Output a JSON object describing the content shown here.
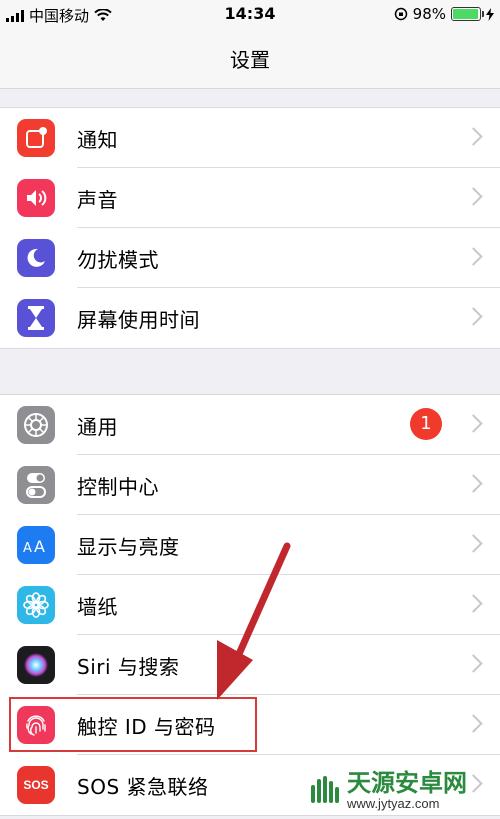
{
  "status_bar": {
    "carrier": "中国移动",
    "time": "14:34",
    "battery_percent": "98%",
    "battery_level": 0.98
  },
  "nav": {
    "title": "设置"
  },
  "group1": [
    {
      "label": "通知",
      "icon": "notifications-icon",
      "color": "#f23c30"
    },
    {
      "label": "声音",
      "icon": "sound-icon",
      "color": "#f2375a"
    },
    {
      "label": "勿扰模式",
      "icon": "moon-icon",
      "color": "#5a52d6"
    },
    {
      "label": "屏幕使用时间",
      "icon": "hourglass-icon",
      "color": "#5a52d6"
    }
  ],
  "group2": [
    {
      "label": "通用",
      "icon": "gear-icon",
      "color": "#8e8e93",
      "badge": "1"
    },
    {
      "label": "控制中心",
      "icon": "toggles-icon",
      "color": "#8e8e93"
    },
    {
      "label": "显示与亮度",
      "icon": "text-size-icon",
      "color": "#1e7cf2"
    },
    {
      "label": "墙纸",
      "icon": "flower-icon",
      "color": "#2fb7e8"
    },
    {
      "label": "Siri 与搜索",
      "icon": "siri-icon",
      "color": "#222222"
    },
    {
      "label": "触控 ID 与密码",
      "icon": "fingerprint-icon",
      "color": "#f0395a"
    },
    {
      "label": "SOS 紧急联络",
      "icon": "sos-icon",
      "color": "#e8352e",
      "icon_text": "SOS"
    }
  ],
  "watermark": {
    "name": "天源安卓网",
    "url": "www.jytyaz.com"
  }
}
